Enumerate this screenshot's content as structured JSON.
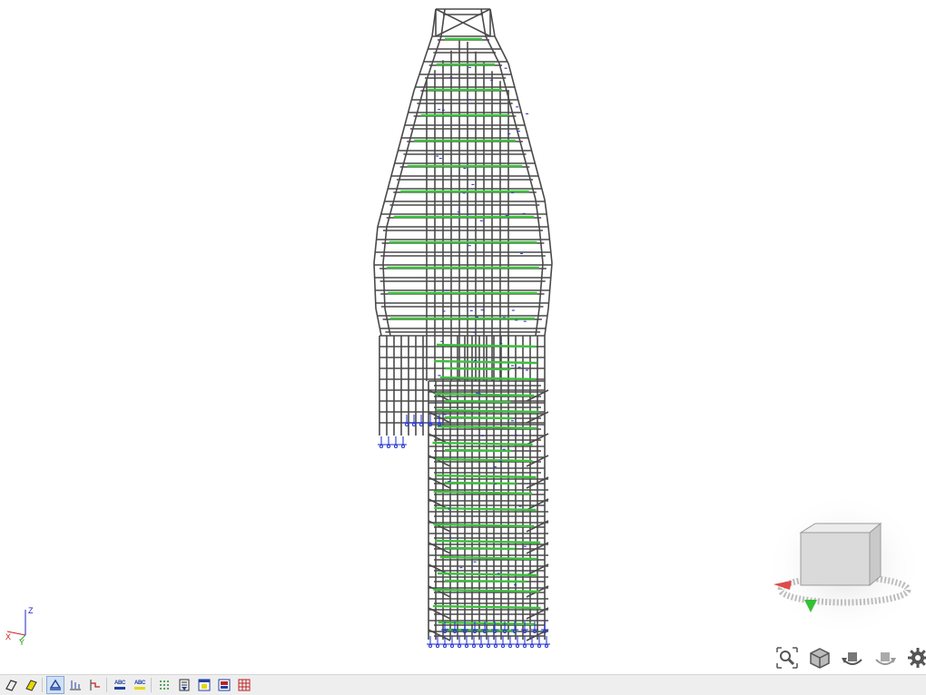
{
  "viewport": {
    "model_name": "scaffold-tower-model",
    "colors": {
      "members": "#4a4a4a",
      "surfaces": "#3fbf3f",
      "supports": "#2a3ad0",
      "background": "#ffffff"
    }
  },
  "axis_triad": {
    "x_label": "X",
    "y_label": "Y",
    "z_label": "Z",
    "colors": {
      "x": "#d02020",
      "y": "#20a020",
      "z": "#2020c0"
    }
  },
  "nav_tools": [
    {
      "name": "zoom-icon"
    },
    {
      "name": "view-cube-icon"
    },
    {
      "name": "rotate-left-icon"
    },
    {
      "name": "rotate-right-icon"
    },
    {
      "name": "settings-gear-icon"
    }
  ],
  "toolbar": {
    "buttons": [
      {
        "icon": "wireframe-icon",
        "active": false
      },
      {
        "icon": "solid-icon",
        "active": false
      },
      {
        "icon": "supports-icon",
        "active": true
      },
      {
        "icon": "loads-icon",
        "active": false
      },
      {
        "icon": "results-icon",
        "active": false
      },
      {
        "icon": "member-labels-icon",
        "text": "ABC",
        "active": false
      },
      {
        "icon": "surface-labels-icon",
        "text": "ABC",
        "active": false
      },
      {
        "icon": "mesh-icon",
        "active": false
      },
      {
        "icon": "section-icon",
        "active": false
      },
      {
        "icon": "window-icon",
        "active": false
      },
      {
        "icon": "print-icon",
        "active": false
      },
      {
        "icon": "grid-icon",
        "active": false
      }
    ]
  }
}
